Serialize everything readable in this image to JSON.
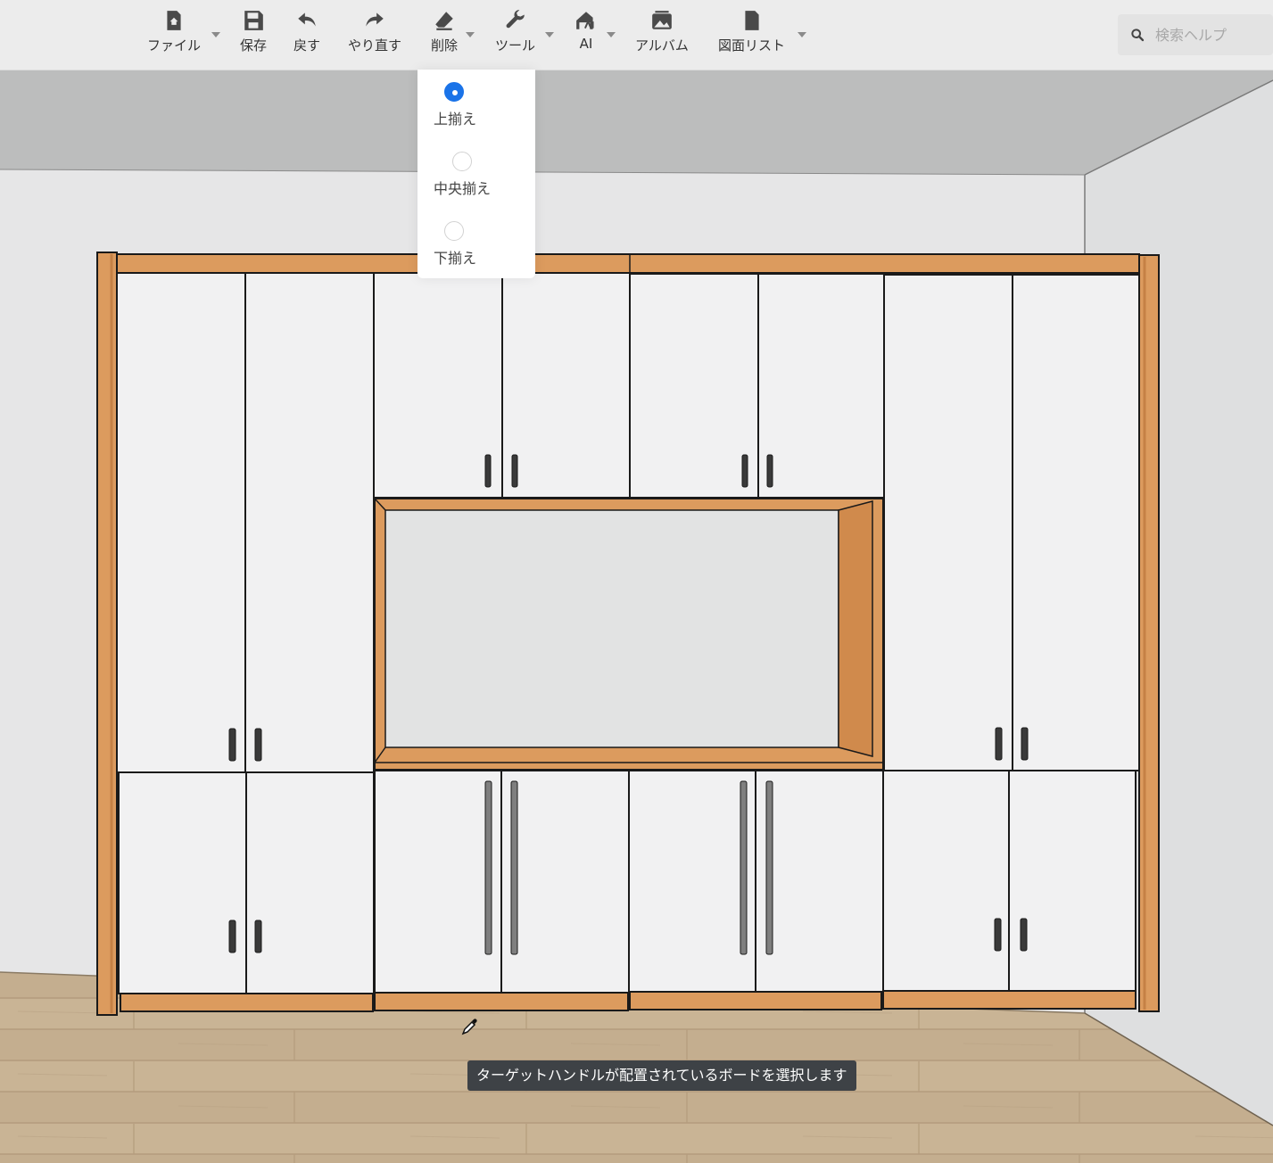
{
  "toolbar": {
    "file": "ファイル",
    "save": "保存",
    "undo": "戻す",
    "redo": "やり直す",
    "delete": "削除",
    "tools": "ツール",
    "ai": "AI",
    "album": "アルバム",
    "drawing_list": "図面リスト"
  },
  "icons": {
    "file": "file-home-icon",
    "save": "floppy-disk-icon",
    "undo": "undo-arrow-icon",
    "redo": "redo-arrow-icon",
    "delete": "eraser-icon",
    "tools": "wrench-icon",
    "ai": "ai-house-icon",
    "album": "image-album-icon",
    "drawing_list": "document-icon",
    "search": "search-icon",
    "cursor": "eyedropper-cursor-icon"
  },
  "search": {
    "placeholder": "検索ヘルプ"
  },
  "align_menu": {
    "options": [
      {
        "label": "上揃え",
        "selected": true
      },
      {
        "label": "中央揃え",
        "selected": false
      },
      {
        "label": "下揃え",
        "selected": false
      }
    ]
  },
  "tooltip": {
    "text": "ターゲットハンドルが配置されているボードを選択します"
  },
  "colors": {
    "accent": "#1a73e8",
    "wood_frame": "#d9975a",
    "door": "#f1f1f2",
    "tooltip_bg": "#3e4246"
  }
}
